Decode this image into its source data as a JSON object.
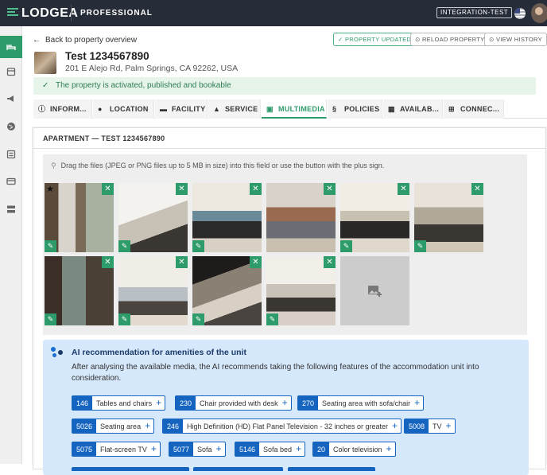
{
  "topbar": {
    "logo": "LODGEA",
    "product": "PROFESSIONAL",
    "environment": "INTEGRATION-TEST"
  },
  "sidebar": {
    "icons": [
      "bed-icon",
      "calendar-icon",
      "megaphone-icon",
      "globe-icon",
      "list-icon",
      "credit-card-icon",
      "server-icon"
    ]
  },
  "header": {
    "back_label": "Back to property overview",
    "buttons": {
      "updated": "PROPERTY UPDATED",
      "reload": "RELOAD PROPERTY",
      "history": "VIEW HISTORY"
    },
    "title": "Test 1234567890",
    "address": "201 E Alejo Rd, Palm Springs, CA 92262, USA",
    "alert": "The property is activated, published and bookable"
  },
  "tabs": [
    {
      "label": "INFORM...",
      "icon": "info-icon"
    },
    {
      "label": "LOCATION",
      "icon": "pin-icon"
    },
    {
      "label": "FACILITY",
      "icon": "bed-icon"
    },
    {
      "label": "SERVICE",
      "icon": "bell-icon"
    },
    {
      "label": "MULTIMEDIA",
      "icon": "image-icon",
      "active": true
    },
    {
      "label": "POLICIES",
      "icon": "section-icon"
    },
    {
      "label": "AVAILAB...",
      "icon": "calendar-icon"
    },
    {
      "label": "CONNEC...",
      "icon": "connect-icon"
    }
  ],
  "unit": {
    "title": "APARTMENT — TEST 1234567890",
    "drop_hint": "Drag the files (JPEG or PNG files up to 5 MB in size) into this field or use the button with the plus sign."
  },
  "colors": {
    "accent": "#2e9b6a",
    "topbar": "#272d38",
    "ai_bg": "#d6e8fb",
    "chip": "#1565c0"
  },
  "ai": {
    "title": "AI recommendation for amenities of the unit",
    "description": "After analysing the available media, the AI recommends taking the following features of the accommodation unit into consideration.",
    "chips": [
      {
        "id": "146",
        "label": "Tables and chairs"
      },
      {
        "id": "230",
        "label": "Chair provided with desk"
      },
      {
        "id": "270",
        "label": "Seating area with sofa/chair"
      },
      {
        "id": "5026",
        "label": "Seating area"
      },
      {
        "id": "246",
        "label": "High Definition (HD) Flat Panel Television - 32 inches or greater"
      },
      {
        "id": "5008",
        "label": "TV"
      },
      {
        "id": "5075",
        "label": "Flat-screen TV"
      },
      {
        "id": "5077",
        "label": "Sofa"
      },
      {
        "id": "5146",
        "label": "Sofa bed"
      },
      {
        "id": "20",
        "label": "Color television"
      }
    ]
  }
}
